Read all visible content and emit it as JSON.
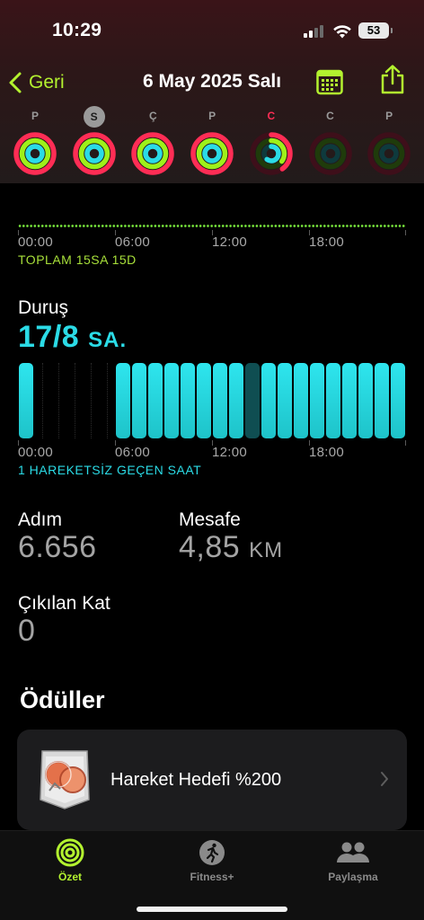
{
  "status": {
    "time": "10:29",
    "battery": "53"
  },
  "nav": {
    "back_label": "Geri",
    "title": "6 May 2025 Salı",
    "calendar_icon": "calendar-icon",
    "share_icon": "share-icon"
  },
  "week": [
    {
      "letter": "P",
      "state": "normal",
      "move": 1.0,
      "exercise": 1.0,
      "stand": 1.0
    },
    {
      "letter": "S",
      "state": "selected",
      "move": 1.0,
      "exercise": 1.0,
      "stand": 1.0
    },
    {
      "letter": "Ç",
      "state": "normal",
      "move": 1.0,
      "exercise": 1.0,
      "stand": 1.0
    },
    {
      "letter": "P",
      "state": "normal",
      "move": 1.0,
      "exercise": 1.0,
      "stand": 1.0
    },
    {
      "letter": "C",
      "state": "today",
      "move": 0.4,
      "exercise": 0.35,
      "stand": 0.6
    },
    {
      "letter": "C",
      "state": "future",
      "move": 0,
      "exercise": 0,
      "stand": 0
    },
    {
      "letter": "P",
      "state": "future",
      "move": 0,
      "exercise": 0,
      "stand": 0
    }
  ],
  "exercise_chart": {
    "time_labels": [
      "00:00",
      "06:00",
      "12:00",
      "18:00"
    ],
    "total": "TOPLAM 15SA 15D"
  },
  "stand": {
    "title": "Duruş",
    "value": "17/8",
    "unit": "SA.",
    "time_labels": [
      "00:00",
      "06:00",
      "12:00",
      "18:00"
    ],
    "inactive_label": "1 HAREKETSİZ GEÇEN SAAT",
    "hours": [
      1,
      0,
      0,
      0,
      0,
      0,
      1,
      1,
      1,
      1,
      1,
      1,
      1,
      1,
      2,
      1,
      1,
      1,
      1,
      1,
      1,
      1,
      1,
      1
    ]
  },
  "stats": {
    "steps_label": "Adım",
    "steps_value": "6.656",
    "distance_label": "Mesafe",
    "distance_value": "4,85",
    "distance_unit": "KM",
    "floors_label": "Çıkılan Kat",
    "floors_value": "0"
  },
  "awards": {
    "title": "Ödüller",
    "items": [
      {
        "name": "Hareket Hedefi %200",
        "icon": "move-goal-badge-icon"
      }
    ]
  },
  "tabbar": {
    "tabs": [
      {
        "label": "Özet",
        "icon": "activity-rings-icon",
        "active": true
      },
      {
        "label": "Fitness+",
        "icon": "running-icon",
        "active": false
      },
      {
        "label": "Paylaşma",
        "icon": "people-icon",
        "active": false
      }
    ]
  },
  "colors": {
    "accent": "#b3f22f",
    "move": "#ff2d55",
    "exercise": "#9ef01a",
    "stand": "#2bdbe6"
  }
}
